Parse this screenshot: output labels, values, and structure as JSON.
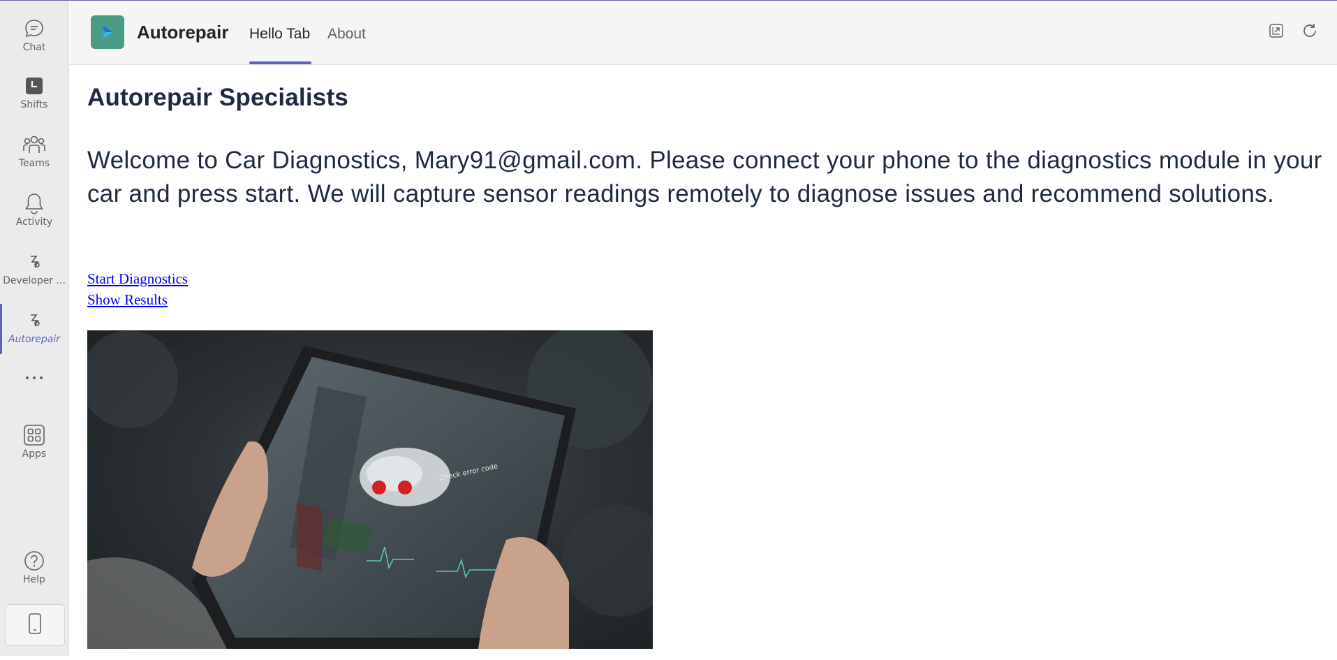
{
  "rail": {
    "items": [
      {
        "label": "Chat",
        "icon": "chat-icon"
      },
      {
        "label": "Shifts",
        "icon": "shifts-icon"
      },
      {
        "label": "Teams",
        "icon": "teams-icon"
      },
      {
        "label": "Activity",
        "icon": "bell-icon"
      },
      {
        "label": "Developer ...",
        "icon": "developer-portal-icon"
      },
      {
        "label": "Autorepair",
        "icon": "autorepair-app-icon",
        "active": true
      },
      {
        "label": "",
        "icon": "more-icon"
      },
      {
        "label": "Apps",
        "icon": "apps-icon"
      },
      {
        "label": "Help",
        "icon": "help-icon"
      }
    ],
    "phone_icon": "mobile-phone-icon"
  },
  "header": {
    "app_name": "Autorepair",
    "tabs": [
      {
        "label": "Hello Tab",
        "selected": true
      },
      {
        "label": "About",
        "selected": false
      }
    ],
    "actions": [
      "popout-icon",
      "refresh-icon"
    ]
  },
  "main": {
    "title": "Autorepair Specialists",
    "welcome": "Welcome to Car Diagnostics, Mary91@gmail.com. Please connect your phone to the diagnostics module in your car and press start. We will capture sensor readings remotely to diagnose issues and recommend solutions.",
    "links": {
      "start": "Start Diagnostics",
      "results": "Show Results"
    },
    "hero_image": "tablet-engine-diagnostics-photo",
    "hero_image_text": "Check error code"
  },
  "colors": {
    "accent": "#5b5fc7",
    "rail_bg": "#ebebeb",
    "header_bg": "#f5f5f5",
    "logo_bg": "#4c9b84",
    "heading_text": "#1e2a40",
    "link": "#0000ee"
  }
}
